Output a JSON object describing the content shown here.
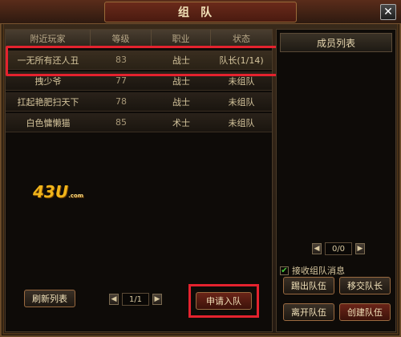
{
  "window": {
    "title": "组队",
    "close": "✕"
  },
  "table": {
    "headers": [
      "附近玩家",
      "等级",
      "职业",
      "状态"
    ],
    "rows": [
      {
        "name": "一无所有还人丑",
        "level": "83",
        "job": "战士",
        "status": "队长(1/14)"
      },
      {
        "name": "拽少爷",
        "level": "77",
        "job": "战士",
        "status": "未组队"
      },
      {
        "name": "扛起艳肥扫天下",
        "level": "78",
        "job": "战士",
        "status": "未组队"
      },
      {
        "name": "白色慵懒猫",
        "level": "85",
        "job": "术士",
        "status": "未组队"
      }
    ]
  },
  "watermark": {
    "main": "43U",
    "sub": ".com"
  },
  "left_bottom": {
    "refresh": "刷新列表",
    "pager": {
      "prev": "◀",
      "page": "1/1",
      "next": "▶"
    },
    "apply": "申请入队"
  },
  "members": {
    "title": "成员列表",
    "pager": {
      "prev": "◀",
      "page": "0/0",
      "next": "▶"
    },
    "accept_checked": "✔",
    "accept_label": "接收组队消息",
    "kick": "踢出队伍",
    "transfer": "移交队长",
    "leave": "离开队伍",
    "create": "创建队伍"
  },
  "colors": {
    "highlight": "#e4222e",
    "accent": "#f0b41a"
  }
}
